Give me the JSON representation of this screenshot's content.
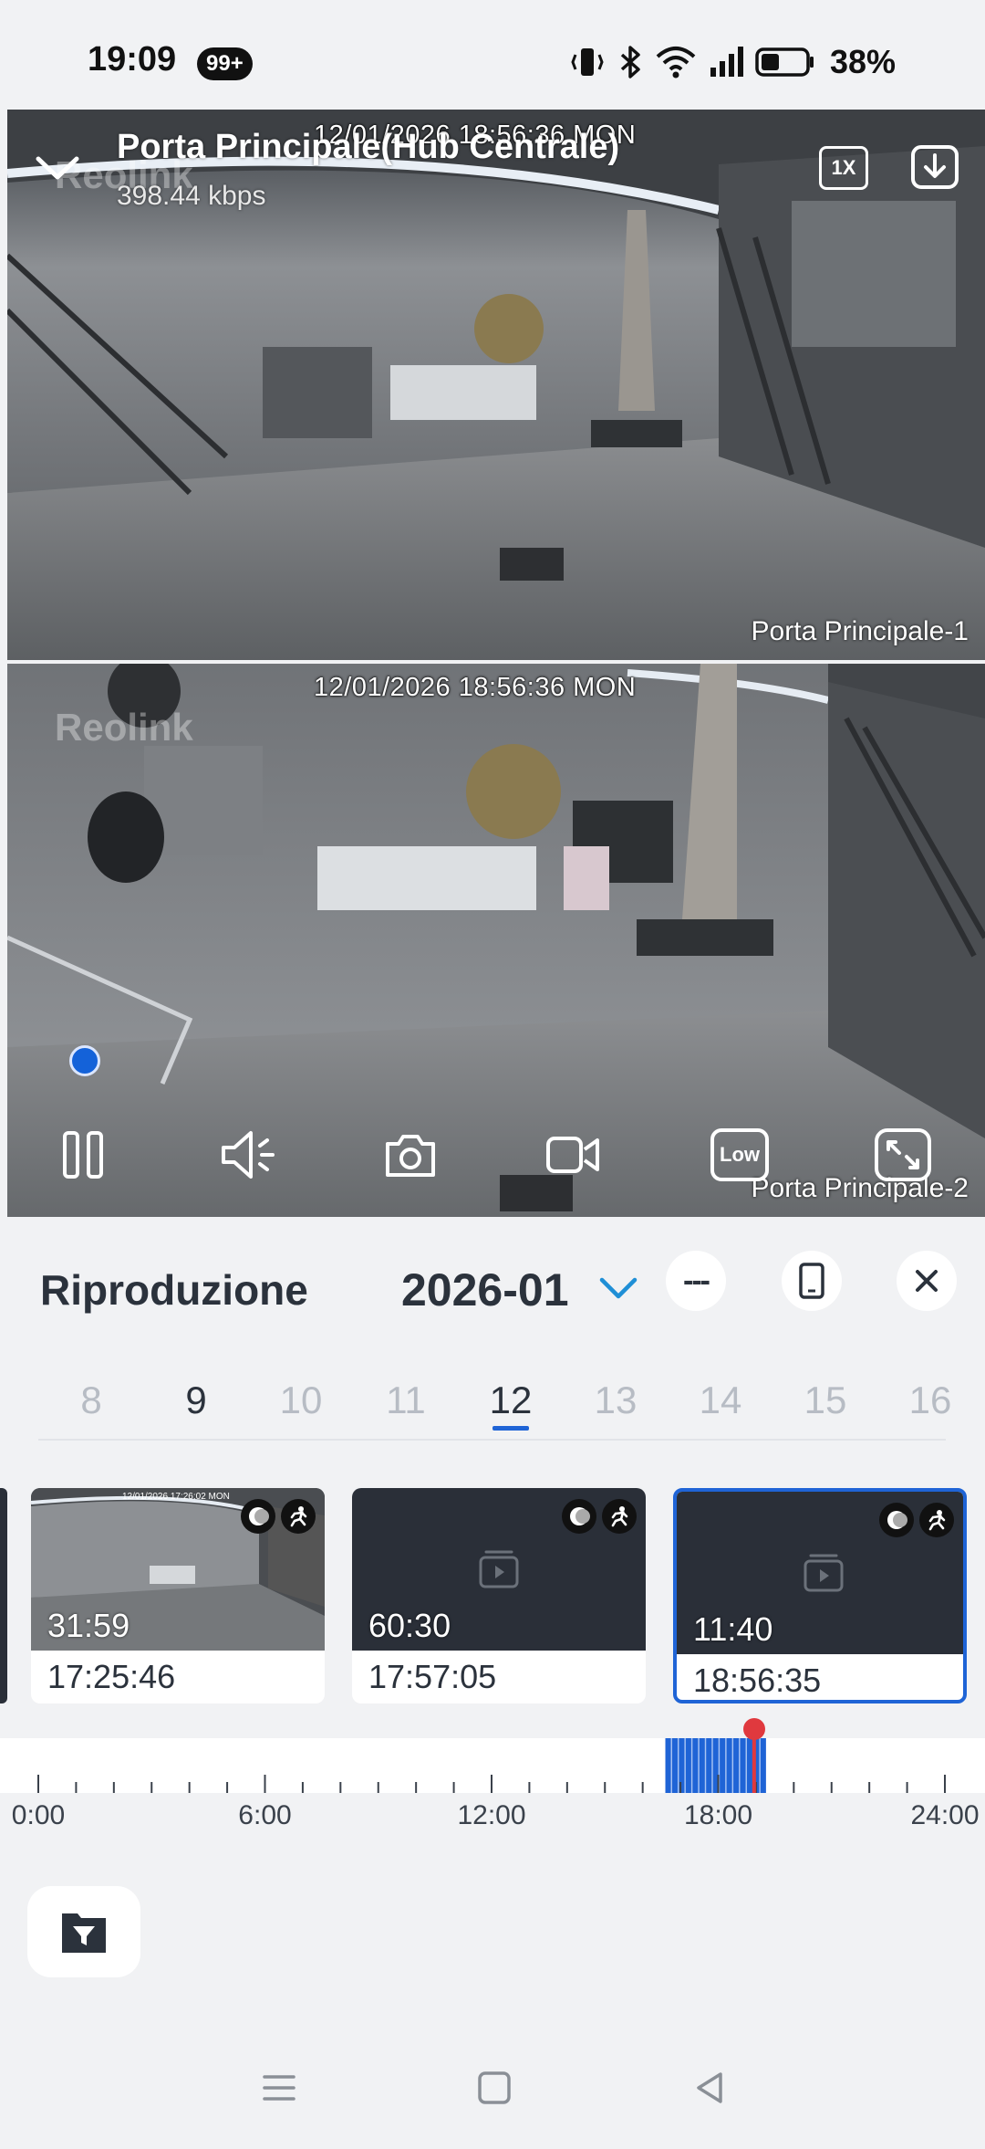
{
  "status_bar": {
    "time": "19:09",
    "notif_badge": "99+",
    "battery_percent": "38%",
    "icons": [
      "vibrate-icon",
      "bluetooth-icon",
      "wifi-icon",
      "signal-icon",
      "battery-icon"
    ]
  },
  "player": {
    "title": "Porta Principale(Hub Centrale)",
    "bitrate": "398.44 kbps",
    "speed_label": "1X",
    "watermark": "Reolink",
    "feeds": [
      {
        "timestamp": "12/01/2026 18:56:36 MON",
        "camera_label": "Porta Principale-1"
      },
      {
        "timestamp": "12/01/2026 18:56:36 MON",
        "camera_label": "Porta Principale-2"
      }
    ],
    "controls": [
      "pause",
      "volume",
      "snapshot",
      "record",
      "quality",
      "fullscreen"
    ],
    "quality_label": "Low"
  },
  "playback": {
    "title": "Riproduzione",
    "month": "2026-01",
    "more_label": "---",
    "days": [
      {
        "label": "8",
        "state": "disabled"
      },
      {
        "label": "9",
        "state": "has-recordings"
      },
      {
        "label": "10",
        "state": "disabled"
      },
      {
        "label": "11",
        "state": "disabled"
      },
      {
        "label": "12",
        "state": "selected"
      },
      {
        "label": "13",
        "state": "disabled"
      },
      {
        "label": "14",
        "state": "disabled"
      },
      {
        "label": "15",
        "state": "disabled"
      },
      {
        "label": "16",
        "state": "disabled"
      }
    ],
    "clips": [
      {
        "duration": "31:59",
        "start_time": "17:25:46",
        "thumb_timestamp": "12/01/2026 17:26:02 MON",
        "has_thumbnail": true,
        "selected": false
      },
      {
        "duration": "60:30",
        "start_time": "17:57:05",
        "has_thumbnail": false,
        "selected": false
      },
      {
        "duration": "11:40",
        "start_time": "18:56:35",
        "has_thumbnail": false,
        "selected": true
      }
    ],
    "timeline": {
      "labels": [
        "0:00",
        "6:00",
        "12:00",
        "18:00",
        "24:00"
      ],
      "range_hours": [
        0,
        24
      ],
      "recorded_ranges_hours": [
        [
          16.6,
          19.2
        ]
      ],
      "cursor_hour": 18.95,
      "accent": "#1f64d6",
      "cursor_color": "#e0393e"
    }
  },
  "colors": {
    "accent": "#1f64d6",
    "panel_bg": "#f1f2f4",
    "text_dark": "#2b323c"
  }
}
